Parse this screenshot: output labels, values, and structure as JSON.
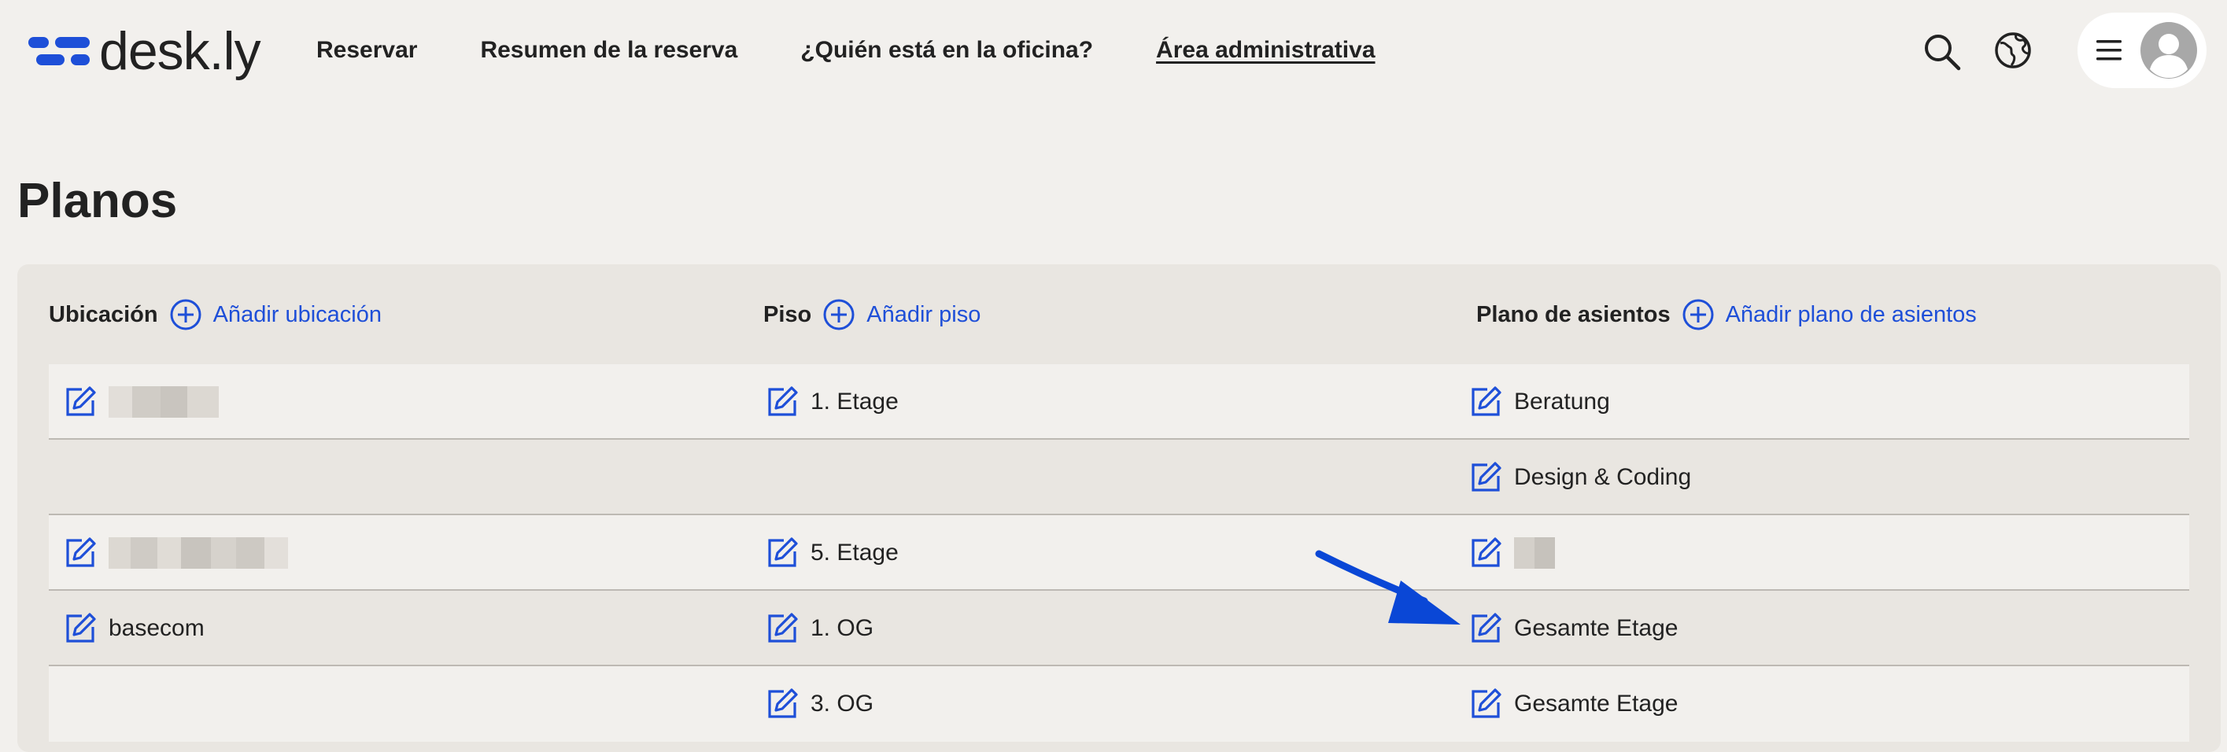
{
  "brand": {
    "name": "desk.ly",
    "color": "#1e4fd8"
  },
  "nav": [
    {
      "label": "Reservar",
      "active": false
    },
    {
      "label": "Resumen de la reserva",
      "active": false
    },
    {
      "label": "¿Quién está en la oficina?",
      "active": false
    },
    {
      "label": "Área administrativa",
      "active": true
    }
  ],
  "header_icons": [
    "search-icon",
    "globe-icon",
    "hamburger-menu-icon",
    "user-avatar-icon"
  ],
  "page": {
    "title": "Planos"
  },
  "columns": {
    "location": {
      "label": "Ubicación",
      "add_label": "Añadir ubicación"
    },
    "floor": {
      "label": "Piso",
      "add_label": "Añadir piso"
    },
    "seating_plan": {
      "label": "Plano de asientos",
      "add_label": "Añadir plano de asientos"
    }
  },
  "rows": [
    {
      "location": "",
      "location_redacted": true,
      "floor": "1. Etage",
      "plan": "Beratung"
    },
    {
      "location": "",
      "floor": "",
      "plan": "Design & Coding"
    },
    {
      "location": "",
      "location_redacted": true,
      "floor": "5. Etage",
      "plan": "",
      "plan_redacted": true
    },
    {
      "location": "basecom",
      "floor": "1. OG",
      "plan": "Gesamte Etage"
    },
    {
      "location": "",
      "floor": "3. OG",
      "plan": "Gesamte Etage"
    }
  ],
  "annotation": {
    "type": "arrow",
    "color": "#0a47d6",
    "target": "row-4-plan-edit"
  }
}
